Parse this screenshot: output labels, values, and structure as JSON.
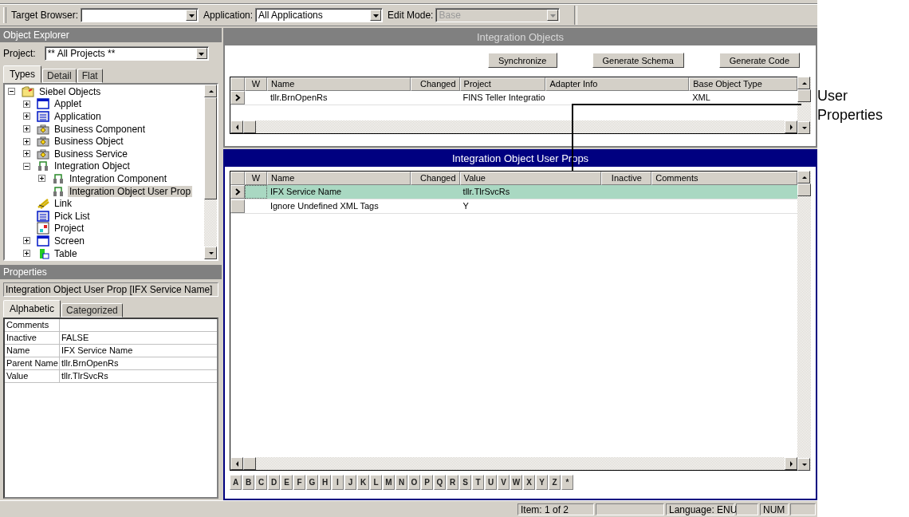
{
  "toolbar": {
    "target_browser": {
      "label": "Target Browser:"
    },
    "application": {
      "label": "Application:",
      "value": "All Applications"
    },
    "edit_mode": {
      "label": "Edit Mode:",
      "value": "Base",
      "disabled": true
    }
  },
  "object_explorer": {
    "title": "Object Explorer",
    "project": {
      "label": "Project:",
      "value": "** All Projects **"
    },
    "tabs": [
      {
        "label": "Types",
        "selected": true
      },
      {
        "label": "Detail",
        "selected": false
      },
      {
        "label": "Flat",
        "selected": false
      }
    ],
    "tree": [
      {
        "label": "Siebel Objects",
        "kind": "folder",
        "expanded": true,
        "selected": false,
        "children": [
          {
            "label": "Applet",
            "kind": "window",
            "expanded": false,
            "selected": false
          },
          {
            "label": "Application",
            "kind": "list",
            "expanded": false,
            "selected": false
          },
          {
            "label": "Business Component",
            "kind": "briefcase",
            "expanded": false,
            "selected": false
          },
          {
            "label": "Business Object",
            "kind": "briefcase",
            "expanded": false,
            "selected": false
          },
          {
            "label": "Business Service",
            "kind": "briefcase",
            "expanded": false,
            "selected": false
          },
          {
            "label": "Integration Object",
            "kind": "connector",
            "expanded": true,
            "selected": false,
            "children": [
              {
                "label": "Integration Component",
                "kind": "connector",
                "expanded": false,
                "selected": false
              },
              {
                "label": "Integration Object User Prop",
                "kind": "connector",
                "selected": true
              }
            ]
          },
          {
            "label": "Link",
            "kind": "link",
            "selected": false
          },
          {
            "label": "Pick List",
            "kind": "list",
            "selected": false
          },
          {
            "label": "Project",
            "kind": "project",
            "selected": false
          },
          {
            "label": "Screen",
            "kind": "window",
            "expanded": false,
            "selected": false
          },
          {
            "label": "Table",
            "kind": "table",
            "expanded": false,
            "selected": false
          }
        ]
      }
    ]
  },
  "properties": {
    "title": "Properties",
    "caption": "Integration Object User Prop [IFX Service Name]",
    "tabs": [
      {
        "label": "Alphabetic",
        "selected": true
      },
      {
        "label": "Categorized",
        "selected": false
      }
    ],
    "rows": [
      {
        "name": "Comments"
      },
      {
        "name": "Inactive",
        "value": "FALSE"
      },
      {
        "name": "Name",
        "value": "IFX Service Name"
      },
      {
        "name": "Parent Name",
        "value": "tllr.BrnOpenRs"
      },
      {
        "name": "Value",
        "value": "tllr.TlrSvcRs"
      }
    ]
  },
  "integration_objects": {
    "title": "Integration Objects",
    "active": false,
    "buttons": [
      "Synchronize",
      "Generate Schema",
      "Generate Code"
    ],
    "columns": [
      {
        "label": "W"
      },
      {
        "label": "Name"
      },
      {
        "label": "Changed"
      },
      {
        "label": "Project"
      },
      {
        "label": "Adapter Info"
      },
      {
        "label": "Base Object Type"
      }
    ],
    "rows": [
      {
        "current": true,
        "selected": false,
        "name": "tllr.BrnOpenRs",
        "project": "FINS Teller Integratio",
        "base_object_type": "XML"
      }
    ]
  },
  "user_props": {
    "title": "Integration Object User Props",
    "active": true,
    "columns": [
      {
        "label": "W"
      },
      {
        "label": "Name"
      },
      {
        "label": "Changed"
      },
      {
        "label": "Value"
      },
      {
        "label": "Inactive"
      },
      {
        "label": "Comments"
      }
    ],
    "rows": [
      {
        "current": true,
        "selected": true,
        "name": "IFX Service Name",
        "value": "tllr.TlrSvcRs"
      },
      {
        "current": false,
        "selected": false,
        "name": "Ignore Undefined XML Tags",
        "value": "Y"
      }
    ],
    "alphabet": [
      "A",
      "B",
      "C",
      "D",
      "E",
      "F",
      "G",
      "H",
      "I",
      "J",
      "K",
      "L",
      "M",
      "N",
      "O",
      "P",
      "Q",
      "R",
      "S",
      "T",
      "U",
      "V",
      "W",
      "X",
      "Y",
      "Z",
      "*"
    ]
  },
  "status_bar": {
    "item": "Item:  1 of 2",
    "language": "Language: ENU",
    "num": "NUM"
  },
  "callout": {
    "label": "User Properties"
  }
}
